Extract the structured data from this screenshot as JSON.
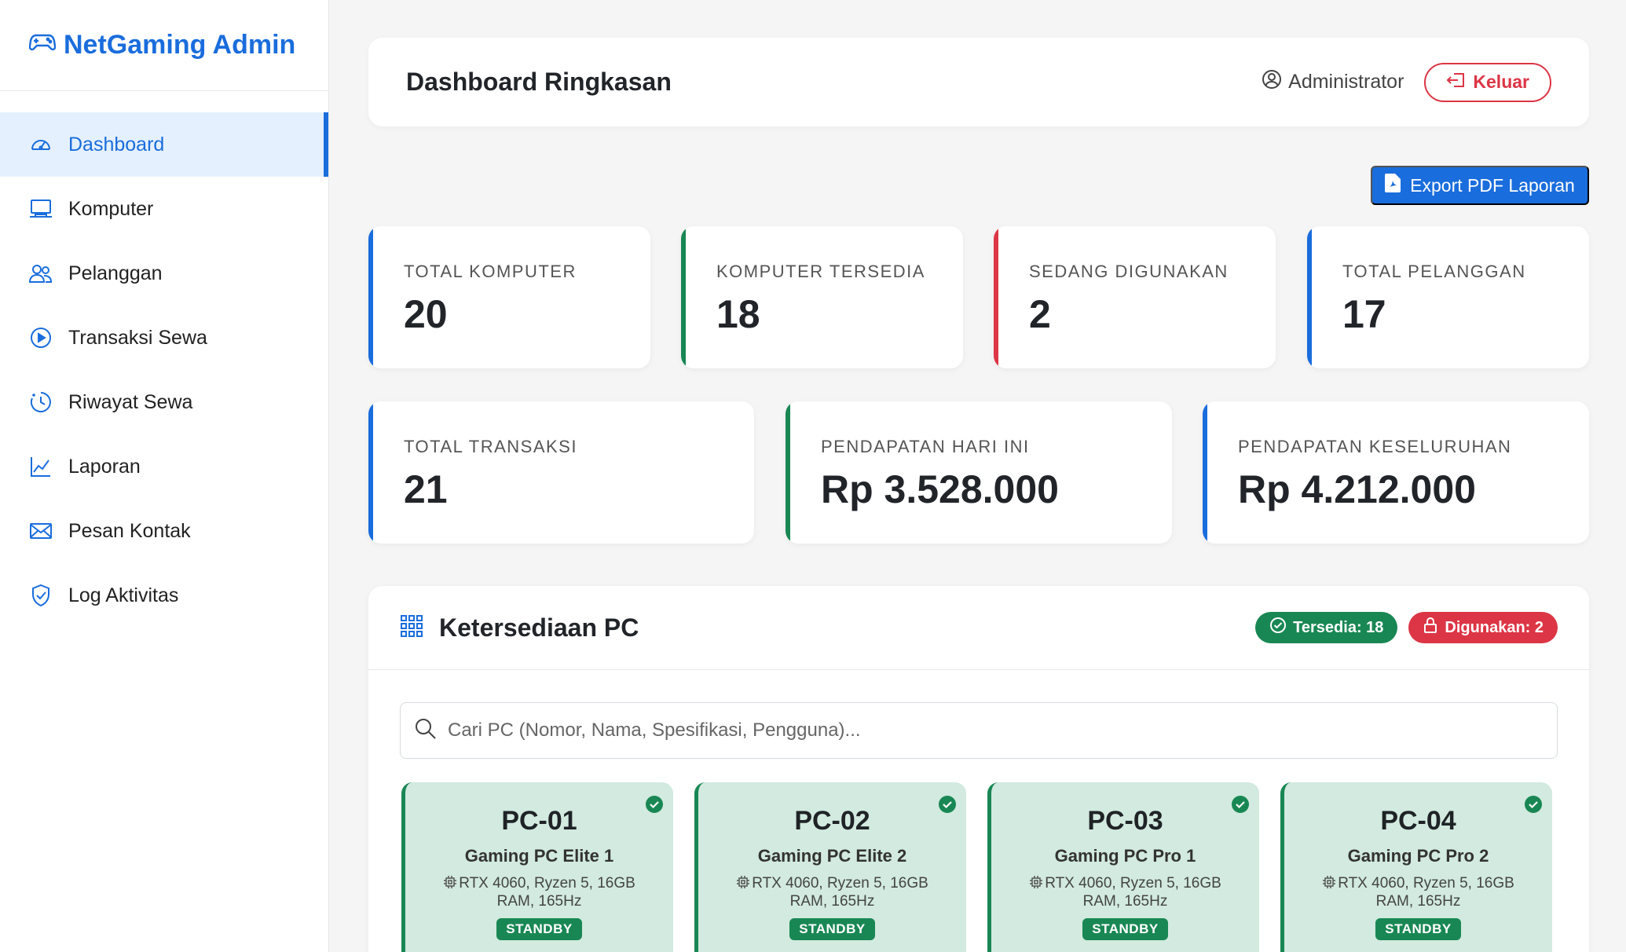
{
  "brand": {
    "name": "NetGaming Admin",
    "icon": "gamepad-icon"
  },
  "sidebar": {
    "items": [
      {
        "label": "Dashboard",
        "icon": "speedometer-icon",
        "active": true
      },
      {
        "label": "Komputer",
        "icon": "laptop-icon"
      },
      {
        "label": "Pelanggan",
        "icon": "people-icon"
      },
      {
        "label": "Transaksi Sewa",
        "icon": "play-circle-icon"
      },
      {
        "label": "Riwayat Sewa",
        "icon": "clock-history-icon"
      },
      {
        "label": "Laporan",
        "icon": "graph-icon"
      },
      {
        "label": "Pesan Kontak",
        "icon": "envelope-icon"
      },
      {
        "label": "Log Aktivitas",
        "icon": "shield-icon"
      }
    ]
  },
  "header": {
    "title": "Dashboard Ringkasan",
    "user": "Administrator",
    "logout": "Keluar"
  },
  "export_label": "Export PDF Laporan",
  "stats": [
    {
      "label": "TOTAL KOMPUTER",
      "value": "20",
      "accent": "#1a6ddc"
    },
    {
      "label": "KOMPUTER TERSEDIA",
      "value": "18",
      "accent": "#198754"
    },
    {
      "label": "SEDANG DIGUNAKAN",
      "value": "2",
      "accent": "#dc3545"
    },
    {
      "label": "TOTAL PELANGGAN",
      "value": "17",
      "accent": "#1a6ddc"
    },
    {
      "label": "TOTAL TRANSAKSI",
      "value": "21",
      "accent": "#1a6ddc"
    },
    {
      "label": "PENDAPATAN HARI INI",
      "value": "Rp 3.528.000",
      "accent": "#198754"
    },
    {
      "label": "PENDAPATAN KESELURUHAN",
      "value": "Rp 4.212.000",
      "accent": "#1a6ddc"
    }
  ],
  "availability": {
    "title": "Ketersediaan PC",
    "badge_available": "Tersedia: 18",
    "badge_used": "Digunakan: 2",
    "search_placeholder": "Cari PC (Nomor, Nama, Spesifikasi, Pengguna)...",
    "pcs": [
      {
        "id": "PC-01",
        "name": "Gaming PC Elite 1",
        "spec": "RTX 4060, Ryzen 5, 16GB RAM, 165Hz",
        "status": "STANDBY"
      },
      {
        "id": "PC-02",
        "name": "Gaming PC Elite 2",
        "spec": "RTX 4060, Ryzen 5, 16GB RAM, 165Hz",
        "status": "STANDBY"
      },
      {
        "id": "PC-03",
        "name": "Gaming PC Pro 1",
        "spec": "RTX 4060, Ryzen 5, 16GB RAM, 165Hz",
        "status": "STANDBY"
      },
      {
        "id": "PC-04",
        "name": "Gaming PC Pro 2",
        "spec": "RTX 4060, Ryzen 5, 16GB RAM, 165Hz",
        "status": "STANDBY"
      }
    ]
  }
}
